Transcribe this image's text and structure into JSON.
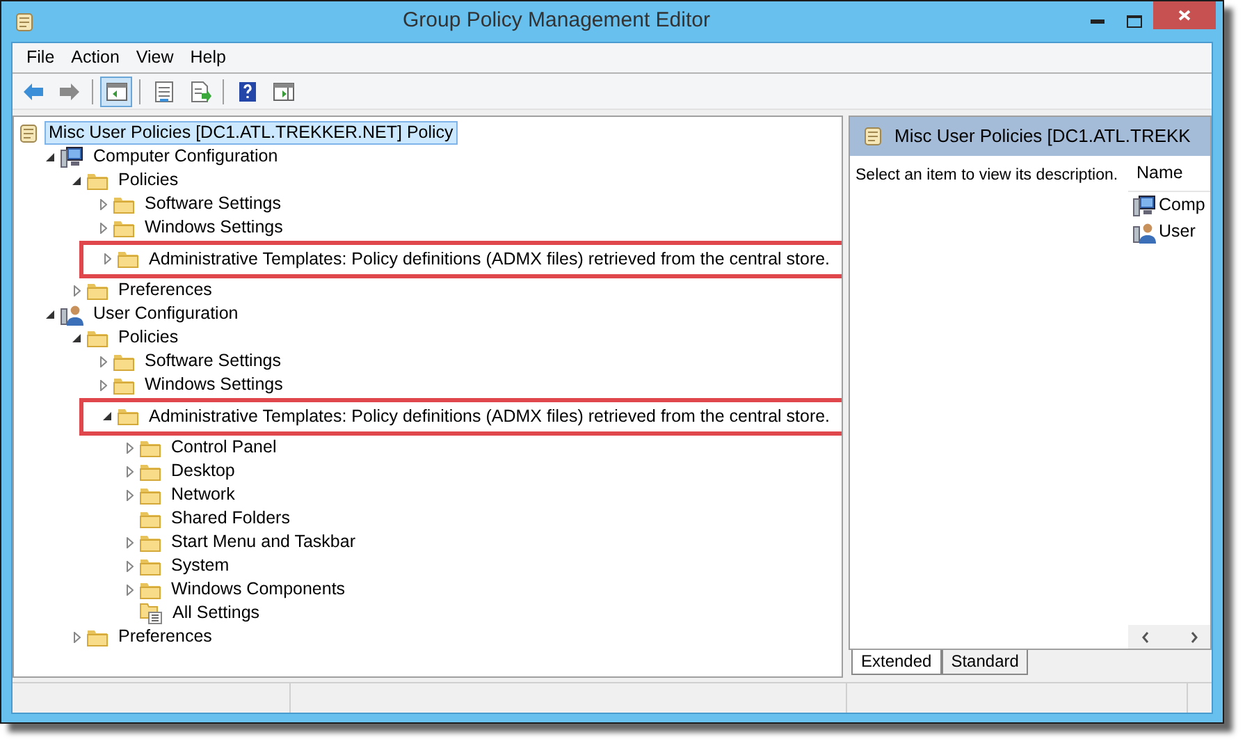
{
  "window": {
    "title": "Group Policy Management Editor"
  },
  "menu": [
    "File",
    "Action",
    "View",
    "Help"
  ],
  "toolbar": [
    {
      "kind": "back",
      "pressed": false
    },
    {
      "kind": "forward",
      "pressed": false
    },
    {
      "kind": "sep"
    },
    {
      "kind": "tree-toggle",
      "pressed": true
    },
    {
      "kind": "sep"
    },
    {
      "kind": "properties",
      "pressed": false
    },
    {
      "kind": "export",
      "pressed": false
    },
    {
      "kind": "sep"
    },
    {
      "kind": "help",
      "pressed": false
    },
    {
      "kind": "action-pane",
      "pressed": false
    }
  ],
  "tree": {
    "label": "Misc User Policies [DC1.ATL.TREKKER.NET] Policy",
    "kind": "policy",
    "selected": true,
    "children": [
      {
        "label": "Computer Configuration",
        "kind": "computer",
        "selected": false,
        "expanded": true,
        "children": [
          {
            "label": "Policies",
            "kind": "folder",
            "selected": false,
            "expanded": true,
            "children": [
              {
                "label": "Software Settings",
                "kind": "folder",
                "selected": false,
                "expanded": false
              },
              {
                "label": "Windows Settings",
                "kind": "folder",
                "selected": false,
                "expanded": false
              },
              {
                "label": "Administrative Templates: Policy definitions (ADMX files) retrieved from the central store.",
                "kind": "folder",
                "selected": false,
                "expanded": false,
                "highlighted": true
              }
            ]
          },
          {
            "label": "Preferences",
            "kind": "folder",
            "selected": false,
            "expanded": false
          }
        ]
      },
      {
        "label": "User Configuration",
        "kind": "user",
        "selected": false,
        "expanded": true,
        "children": [
          {
            "label": "Policies",
            "kind": "folder",
            "selected": false,
            "expanded": true,
            "children": [
              {
                "label": "Software Settings",
                "kind": "folder",
                "selected": false,
                "expanded": false
              },
              {
                "label": "Windows Settings",
                "kind": "folder",
                "selected": false,
                "expanded": false
              },
              {
                "label": "Administrative Templates: Policy definitions (ADMX files) retrieved from the central store.",
                "kind": "folder",
                "selected": false,
                "expanded": true,
                "highlighted": true,
                "children": [
                  {
                    "label": "Control Panel",
                    "kind": "folder",
                    "selected": false,
                    "expanded": false
                  },
                  {
                    "label": "Desktop",
                    "kind": "folder",
                    "selected": false,
                    "expanded": false
                  },
                  {
                    "label": "Network",
                    "kind": "folder",
                    "selected": false,
                    "expanded": false
                  },
                  {
                    "label": "Shared Folders",
                    "kind": "folder",
                    "selected": false
                  },
                  {
                    "label": "Start Menu and Taskbar",
                    "kind": "folder",
                    "selected": false,
                    "expanded": false
                  },
                  {
                    "label": "System",
                    "kind": "folder",
                    "selected": false,
                    "expanded": false
                  },
                  {
                    "label": "Windows Components",
                    "kind": "folder",
                    "selected": false,
                    "expanded": false
                  },
                  {
                    "label": "All Settings",
                    "kind": "settings",
                    "selected": false
                  }
                ]
              }
            ]
          },
          {
            "label": "Preferences",
            "kind": "folder",
            "selected": false,
            "expanded": false
          }
        ]
      }
    ]
  },
  "right_pane": {
    "title": "Misc User Policies [DC1.ATL.TREKK",
    "description": "Select an item to view its description.",
    "columns": [
      "Name"
    ],
    "items": [
      {
        "label": "Comp",
        "kind": "computer"
      },
      {
        "label": "User",
        "kind": "user"
      }
    ],
    "tabs": [
      {
        "label": "Extended",
        "selected": true
      },
      {
        "label": "Standard",
        "selected": false
      }
    ]
  }
}
